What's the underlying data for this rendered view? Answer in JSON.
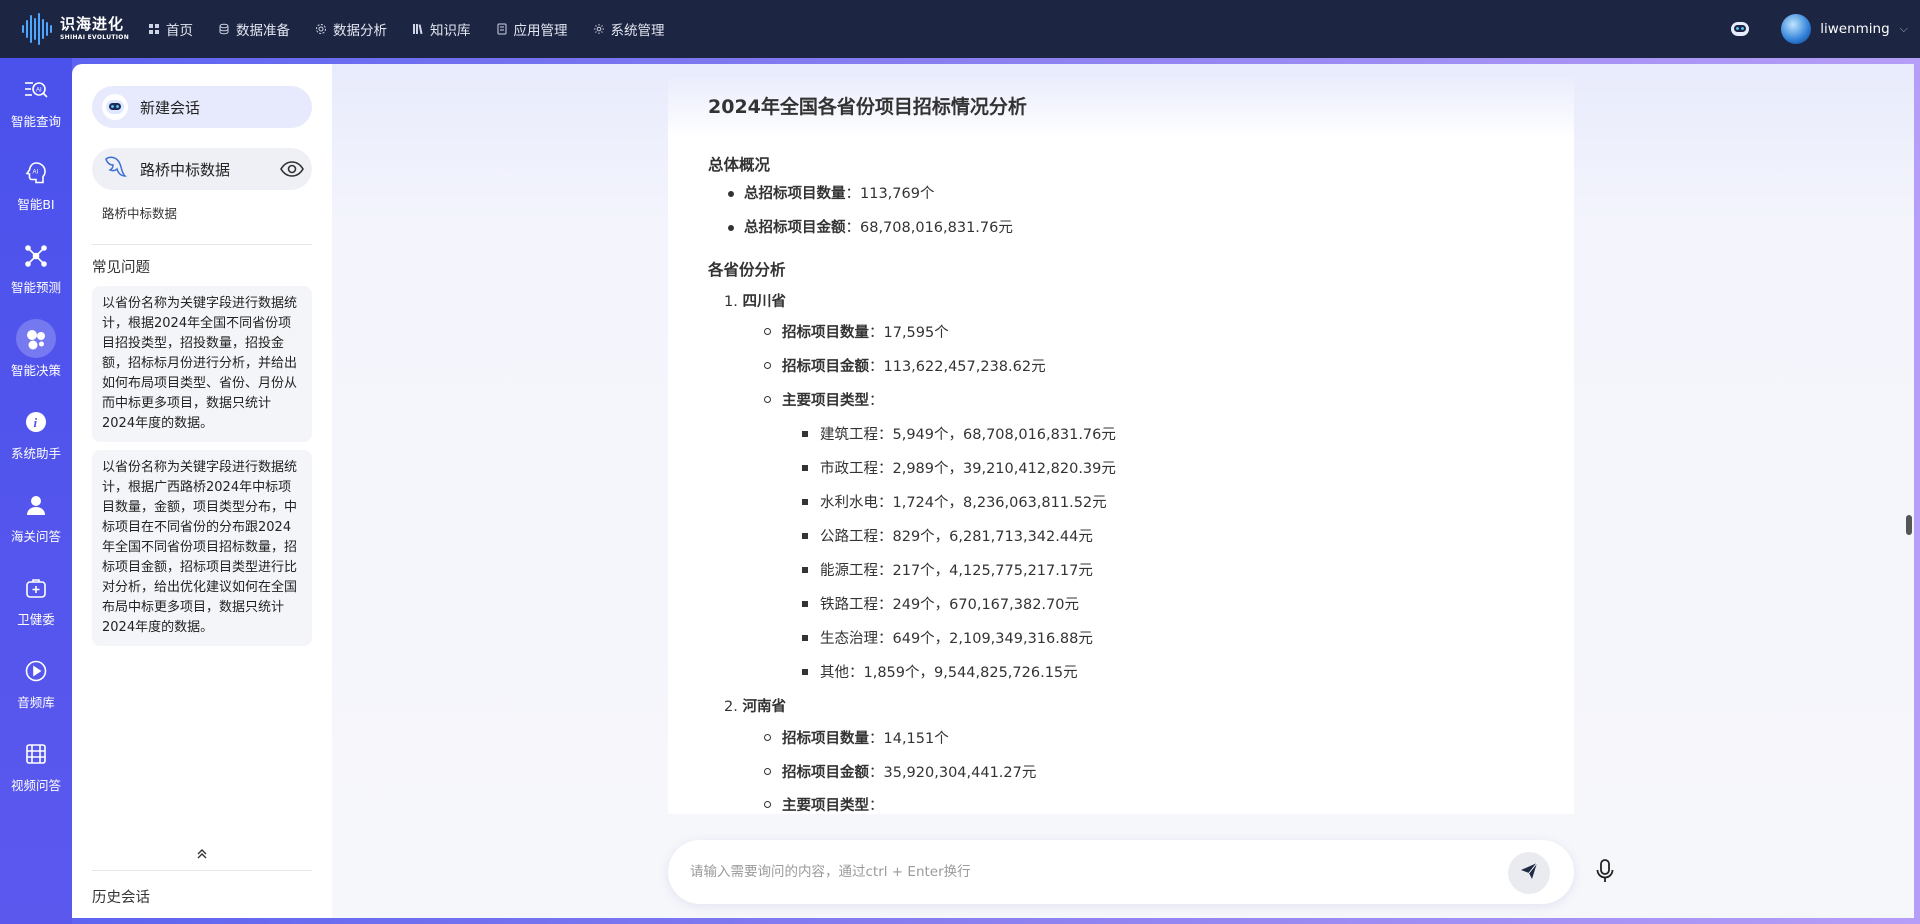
{
  "brand": {
    "name_cn": "识海进化",
    "name_en": "SHIHAI EVOLUTION"
  },
  "nav": [
    {
      "label": "首页",
      "icon": "grid-icon"
    },
    {
      "label": "数据准备",
      "icon": "database-icon"
    },
    {
      "label": "数据分析",
      "icon": "gear-icon"
    },
    {
      "label": "知识库",
      "icon": "book-icon"
    },
    {
      "label": "应用管理",
      "icon": "doc-icon"
    },
    {
      "label": "系统管理",
      "icon": "settings-icon"
    }
  ],
  "user": {
    "name": "liwenming"
  },
  "rail": [
    {
      "label": "智能查询",
      "icon": "ai-search-icon"
    },
    {
      "label": "智能BI",
      "icon": "ai-bi-icon"
    },
    {
      "label": "智能预测",
      "icon": "network-icon"
    },
    {
      "label": "智能决策",
      "icon": "decision-icon",
      "active": true
    },
    {
      "label": "系统助手",
      "icon": "info-icon"
    },
    {
      "label": "海关问答",
      "icon": "user-icon"
    },
    {
      "label": "卫健委",
      "icon": "medical-icon"
    },
    {
      "label": "音频库",
      "icon": "play-icon"
    },
    {
      "label": "视频问答",
      "icon": "film-icon"
    }
  ],
  "panel": {
    "new_chat": "新建会话",
    "datasource": "路桥中标数据",
    "datasource_sub": "路桥中标数据",
    "faq_title": "常见问题",
    "faq": [
      "以省份名称为关键字段进行数据统计，根据2024年全国不同省份项目招投类型，招投数量，招投金额，招标标月份进行分析，并给出如何布局项目类型、省份、月份从而中标更多项目，数据只统计2024年度的数据。",
      "以省份名称为关键字段进行数据统计，根据广西路桥2024年中标项目数量，金额，项目类型分布，中标项目在不同省份的分布跟2024年全国不同省份项目招标数量，招标项目金额，招标项目类型进行比对分析，给出优化建议如何在全国布局中标更多项目，数据只统计2024年度的数据。"
    ],
    "history": "历史会话"
  },
  "doc": {
    "title": "2024年全国各省份项目招标情况分析",
    "overview_title": "总体概况",
    "overview": [
      {
        "label": "总招标项目数量",
        "value": "：113,769个"
      },
      {
        "label": "总招标项目金额",
        "value": "：68,708,016,831.76元"
      }
    ],
    "province_title": "各省份分析",
    "provinces": [
      {
        "num": "1.",
        "name": "四川省",
        "count_label": "招标项目数量",
        "count": "：17,595个",
        "amount_label": "招标项目金额",
        "amount": "：113,622,457,238.62元",
        "types_label": "主要项目类型",
        "types_colon": "：",
        "types": [
          "建筑工程：5,949个，68,708,016,831.76元",
          "市政工程：2,989个，39,210,412,820.39元",
          "水利水电：1,724个，8,236,063,811.52元",
          "公路工程：829个，6,281,713,342.44元",
          "能源工程：217个，4,125,775,217.17元",
          "铁路工程：249个，670,167,382.70元",
          "生态治理：649个，2,109,349,316.88元",
          "其他：1,859个，9,544,825,726.15元"
        ]
      },
      {
        "num": "2.",
        "name": "河南省",
        "count_label": "招标项目数量",
        "count": "：14,151个",
        "amount_label": "招标项目金额",
        "amount": "：35,920,304,441.27元",
        "types_label": "主要项目类型",
        "types_colon": "："
      }
    ]
  },
  "input": {
    "placeholder": "请输入需要询问的内容，通过ctrl + Enter换行"
  }
}
